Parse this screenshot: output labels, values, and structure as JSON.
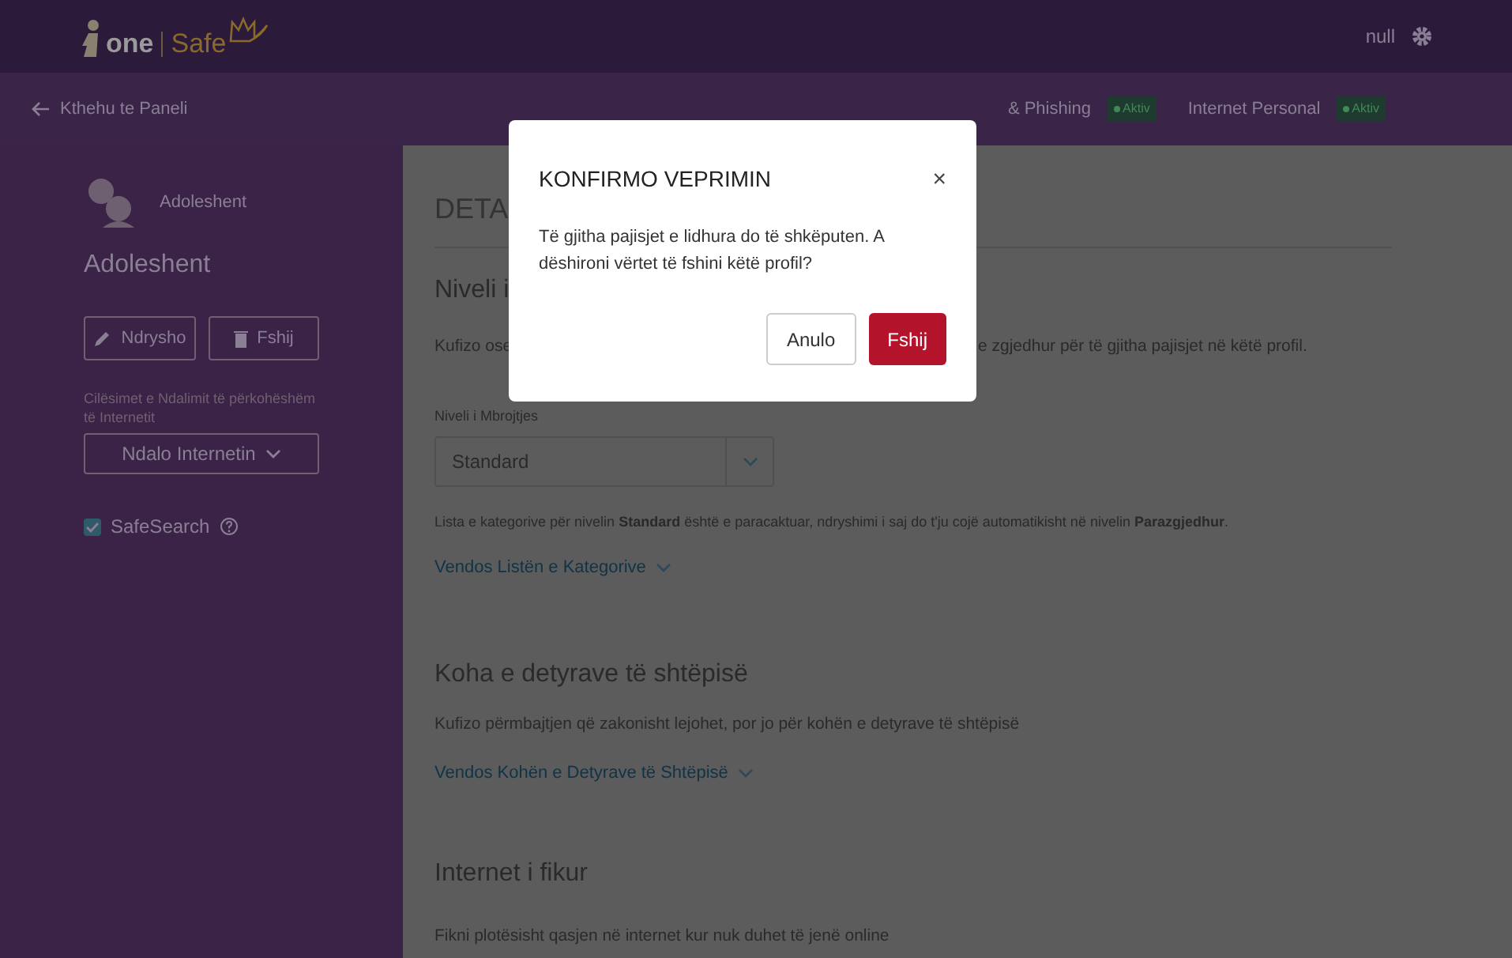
{
  "header": {
    "logo_one": "one",
    "logo_safe": "Safe",
    "user": "null"
  },
  "subnav": {
    "back": "Kthehu te Paneli",
    "items": [
      {
        "label": "& Phishing",
        "badge": "Aktiv"
      },
      {
        "label": "Internet Personal",
        "badge": "Aktiv"
      }
    ]
  },
  "sidebar": {
    "profile_name": "Adoleshent",
    "title": "Adoleshent",
    "buttons": [
      {
        "label": "Ndrysho",
        "kind": "edit"
      },
      {
        "label": "Fshij",
        "kind": "delete"
      }
    ],
    "pause_label": "Cilësimet e Ndalimit të përkohëshëm të Internetit",
    "pause_dropdown": "Ndalo Internetin",
    "safesearch": {
      "label": "SafeSearch",
      "checked": true
    }
  },
  "main": {
    "title": "DETA",
    "level_section": {
      "title": "Niveli i",
      "description_left": "Kufizo ose",
      "description_right": "e zgjedhur për të gjitha pajisjet në këtë profil.",
      "field_label": "Niveli i Mbrojtjes",
      "select_value": "Standard",
      "note": "Lista e kategorive për nivelin **Standard** është e paracaktuar, ndryshimi i saj do t'ju cojë automatikisht në nivelin **Parazgjedhur**.",
      "link": "Vendos Listën e Kategorive"
    },
    "sections": [
      {
        "title": "Koha e detyrave të shtëpisë",
        "description": "Kufizo përmbajtjen që zakonisht lejohet, por jo për kohën e detyrave të shtëpisë",
        "link": "Vendos Kohën e Detyrave të Shtëpisë"
      },
      {
        "title": "Internet i fikur",
        "description": "Fikni plotësisht qasjen në internet kur nuk duhet të jenë online"
      }
    ]
  },
  "modal": {
    "title": "KONFIRMO VEPRIMIN",
    "close": "×",
    "message": "Të gjitha pajisjet e lidhura do të shkëputen. A dëshironi vërtet të fshini këtë profil?",
    "buttons": [
      {
        "label": "Anulo",
        "kind": "secondary"
      },
      {
        "label": "Fshij",
        "kind": "danger"
      }
    ]
  }
}
